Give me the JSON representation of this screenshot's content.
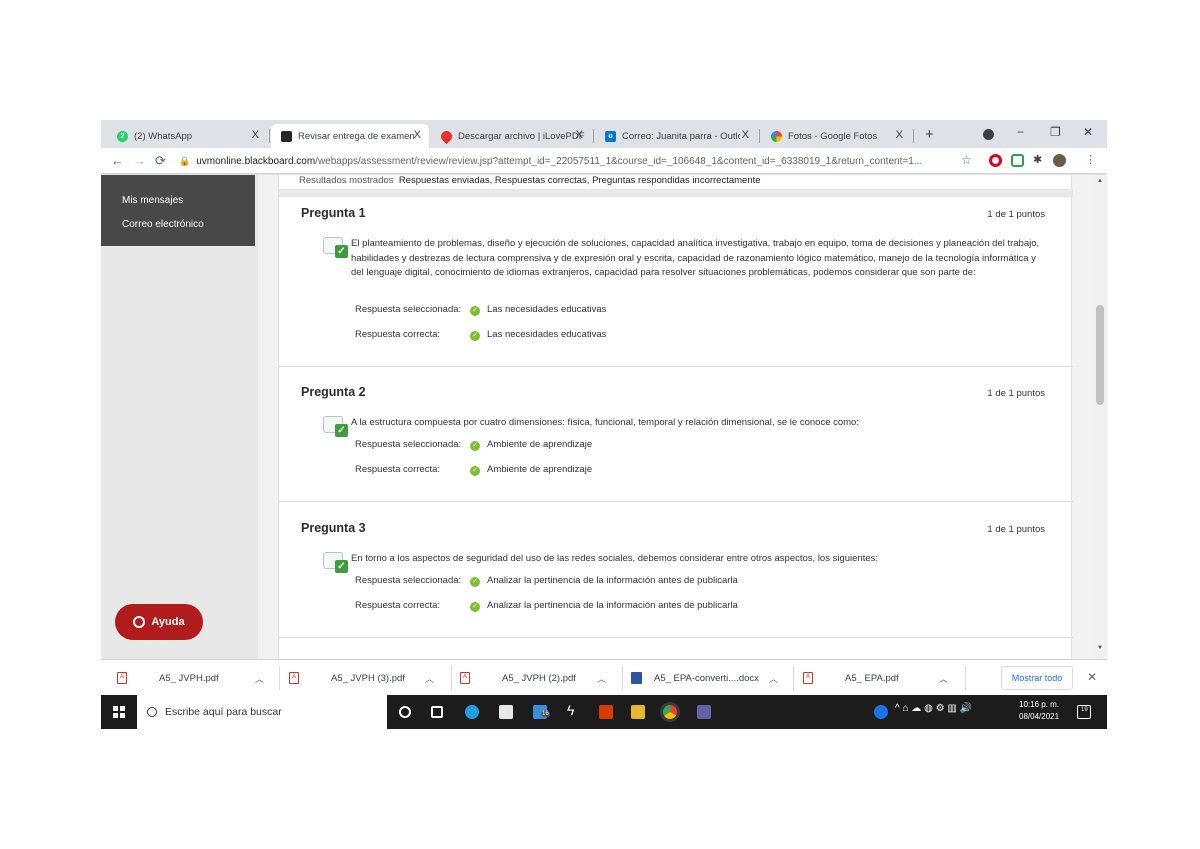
{
  "browser": {
    "tabs": [
      {
        "label": "(2) WhatsApp",
        "color": "#25d366"
      },
      {
        "label": "Revisar entrega de examen: /",
        "color": "#262626",
        "active": true
      },
      {
        "label": "Descargar archivo | iLovePDF",
        "color": "#e5322d"
      },
      {
        "label": "Correo: Juanita parra - Outlo",
        "color": "#0078d4"
      },
      {
        "label": "Fotos - Google Fotos",
        "color": "#fbbc04"
      }
    ],
    "close_glyph": "X",
    "new_tab_glyph": "+",
    "url_host": "uvmonline.blackboard.com",
    "url_path": "/webapps/assessment/review/review.jsp?attempt_id=_22057511_1&course_id=_106648_1&content_id=_6338019_1&return_content=1..."
  },
  "sidebar": {
    "items": [
      "Mis mensajes",
      "Correo electrónico"
    ],
    "help_label": "Ayuda"
  },
  "results": {
    "label": "Resultados mostrados",
    "value": "Respuestas enviadas, Respuestas correctas, Preguntas respondidas incorrectamente"
  },
  "answer_labels": {
    "selected": "Respuesta seleccionada:",
    "correct": "Respuesta correcta:"
  },
  "questions": [
    {
      "title": "Pregunta 1",
      "points": "1 de 1 puntos",
      "text": "El planteamiento de problemas, diseño y ejecución de soluciones, capacidad analítica investigativa, trabajo en equipo, toma de decisiones y planeación del trabajo, habilidades y destrezas de lectura comprensiva y de expresión oral y escrita, capacidad de razonamiento lógico matemático, manejo de la tecnología informática y del lenguaje digital, conocimiento de idiomas extranjeros, capacidad para resolver situaciones problemáticas, podemos considerar que son parte de:",
      "selected": "Las necesidades educativas",
      "correct": "Las necesidades educativas"
    },
    {
      "title": "Pregunta 2",
      "points": "1 de 1 puntos",
      "text": "A la estructura compuesta por cuatro dimensiones: física, funcional, temporal y relación dimensional, se le conoce como:",
      "selected": "Ambiente de aprendizaje",
      "correct": "Ambiente de aprendizaje"
    },
    {
      "title": "Pregunta 3",
      "points": "1 de 1 puntos",
      "text": "En torno a los aspectos de seguridad del uso de las redes sociales, debemos considerar entre otros aspectos, los siguientes:",
      "selected": "Analizar la pertinencia de la información antes de publicarla",
      "correct": "Analizar la pertinencia de la información antes de publicarla"
    }
  ],
  "downloads": {
    "files": [
      "A5_ JVPH.pdf",
      "A5_ JVPH (3).pdf",
      "A5_ JVPH (2).pdf",
      "A5_ EPA-converti....docx",
      "A5_ EPA.pdf"
    ],
    "show_all": "Mostrar todo"
  },
  "taskbar": {
    "search_placeholder": "Escribe aquí para buscar",
    "time": "10:16 p. m.",
    "date": "08/04/2021",
    "notification_count": "19",
    "tray_badge": "16"
  }
}
